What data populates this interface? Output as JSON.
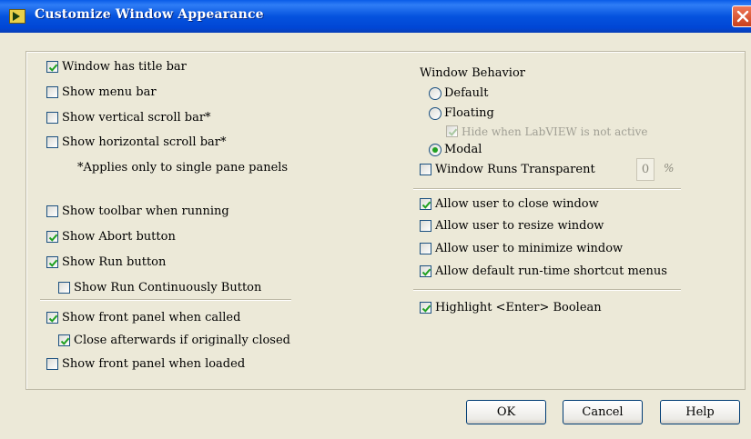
{
  "window": {
    "title": "Customize Window Appearance"
  },
  "left_options": [
    {
      "label": "Window has title bar",
      "checked": true
    },
    {
      "label": "Show menu bar",
      "checked": false
    },
    {
      "label": "Show vertical scroll bar*",
      "checked": false
    },
    {
      "label": "Show horizontal scroll bar*",
      "checked": false
    },
    {
      "label": "Show toolbar when running",
      "checked": false
    },
    {
      "label": "Show Abort button",
      "checked": true
    },
    {
      "label": "Show Run button",
      "checked": true
    },
    {
      "label": "Show Run Continuously Button",
      "checked": false
    },
    {
      "label": "Show front panel when called",
      "checked": true
    },
    {
      "label": "Close afterwards if originally closed",
      "checked": true
    },
    {
      "label": "Show front panel when loaded",
      "checked": false
    }
  ],
  "note": "*Applies only to single pane panels",
  "window_behavior": {
    "heading": "Window Behavior",
    "options": [
      {
        "label": "Default",
        "selected": false
      },
      {
        "label": "Floating",
        "selected": false
      },
      {
        "label": "Modal",
        "selected": true
      }
    ],
    "hide_inactive": {
      "label": "Hide when LabVIEW is not active",
      "checked": true,
      "disabled": true
    }
  },
  "transparent": {
    "label": "Window Runs Transparent",
    "checked": false,
    "value": "0",
    "unit": "%"
  },
  "right_options": [
    {
      "label": "Allow user to close window",
      "checked": true
    },
    {
      "label": "Allow user to resize window",
      "checked": false
    },
    {
      "label": "Allow user to minimize window",
      "checked": false
    },
    {
      "label": "Allow default run-time shortcut menus",
      "checked": true
    },
    {
      "label": "Highlight <Enter> Boolean",
      "checked": true
    }
  ],
  "buttons": {
    "ok": "OK",
    "cancel": "Cancel",
    "help": "Help"
  },
  "colors": {
    "title_bar": "#0553DE",
    "dialog_bg": "#ECE9D8",
    "check": "#21A121",
    "close": "#D9532F"
  }
}
